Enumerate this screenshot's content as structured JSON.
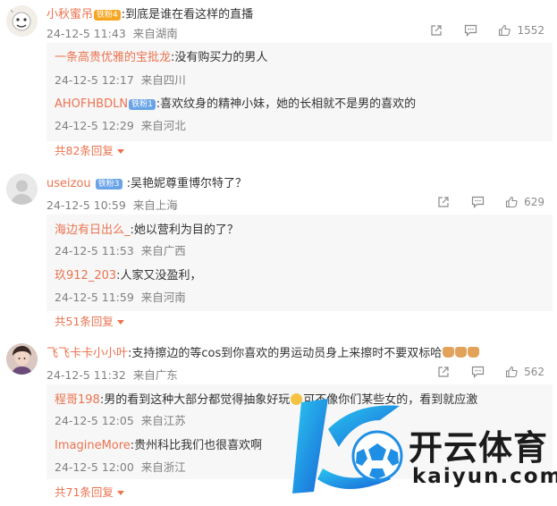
{
  "comments": [
    {
      "user": "小秋蜜吊",
      "badge": "铁粉4",
      "text": ":到底是谁在看这样的直播",
      "time": "24-12-5 11:43",
      "location": "来自湖南",
      "likes": "1552",
      "replies": [
        {
          "user": "一条高贵优雅的宝批龙",
          "badge": "",
          "text": ":没有购买力的男人",
          "time": "24-12-5 12:17",
          "location": "来自四川"
        },
        {
          "user": "AHOFHBDLN",
          "badge": "铁粉1",
          "text": ":喜欢纹身的精神小妹，她的长相就不是男的喜欢的",
          "time": "24-12-5 12:29",
          "location": "来自河北"
        }
      ],
      "more": "共82条回复"
    },
    {
      "user": "useizou",
      "badge": "铁粉3",
      "text": ":吴艳妮尊重博尔特了？",
      "time": "24-12-5 10:59",
      "location": "来自上海",
      "likes": "629",
      "replies": [
        {
          "user": "海边有日出么_",
          "badge": "",
          "text": ":她以营利为目的了？",
          "time": "24-12-5 11:53",
          "location": "来自广西"
        },
        {
          "user": "玖912_203",
          "badge": "",
          "text": ":人家又没盈利，",
          "time": "24-12-5 11:59",
          "location": "来自河南"
        }
      ],
      "more": "共51条回复"
    },
    {
      "user": "飞飞卡卡小小叶",
      "badge": "",
      "text": ":支持擦边的等cos到你喜欢的男运动员身上来擦时不要双标哈",
      "time": "24-12-5 11:32",
      "location": "来自广东",
      "likes": "562",
      "replies": [
        {
          "user": "程哥198",
          "badge": "",
          "text": ":男的看到这种大部分都觉得抽象好玩",
          "text2": "可不像你们某些女的，看到就应激",
          "time": "24-12-5 12:05",
          "location": "来自江苏"
        },
        {
          "user": "ImagineMore",
          "badge": "",
          "text": ":贵州科比我们也很喜欢啊",
          "time": "24-12-5 12:00",
          "location": "来自浙江"
        }
      ],
      "more": "共71条回复"
    }
  ],
  "watermark": {
    "brand_cn": "开云体育",
    "brand_en": "kaiyun.com",
    "colors": {
      "primary": "#1f8fe5",
      "accent": "#2bc6f0",
      "text": "#1b1b1b"
    }
  },
  "icons": {
    "share": "share-icon",
    "comment": "comment-icon",
    "like": "like-icon",
    "caret": "caret-down-icon"
  }
}
